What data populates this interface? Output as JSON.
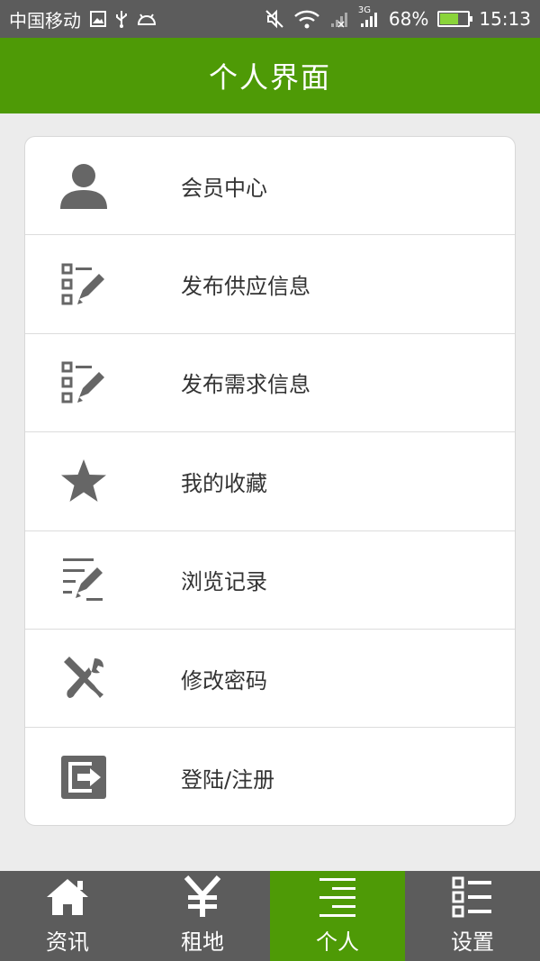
{
  "status_bar": {
    "carrier": "中国移动",
    "network": "3G",
    "battery": "68%",
    "time": "15:13"
  },
  "header": {
    "title": "个人界面"
  },
  "menu": {
    "items": [
      {
        "label": "会员中心",
        "icon": "user-icon"
      },
      {
        "label": "发布供应信息",
        "icon": "edit-list-icon"
      },
      {
        "label": "发布需求信息",
        "icon": "edit-list-icon"
      },
      {
        "label": "我的收藏",
        "icon": "star-icon"
      },
      {
        "label": "浏览记录",
        "icon": "history-edit-icon"
      },
      {
        "label": "修改密码",
        "icon": "tools-icon"
      },
      {
        "label": "登陆/注册",
        "icon": "login-icon"
      }
    ]
  },
  "bottom_nav": {
    "tabs": [
      {
        "label": "资讯",
        "icon": "home-icon"
      },
      {
        "label": "租地",
        "icon": "yen-icon"
      },
      {
        "label": "个人",
        "icon": "person-lines-icon",
        "active": true
      },
      {
        "label": "设置",
        "icon": "list-settings-icon"
      }
    ]
  },
  "colors": {
    "primary": "#4e9a06",
    "statusbar": "#5c5c5c",
    "icon_gray": "#666666"
  }
}
